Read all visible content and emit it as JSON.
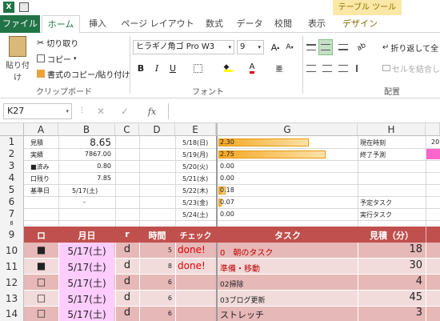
{
  "ribbon_tabs": [
    "ファイル",
    "ホーム",
    "挿入",
    "ページ レイアウト",
    "数式",
    "データ",
    "校閲",
    "表示",
    "デザイン"
  ],
  "context_tab": "テーブル ツール",
  "clipboard": {
    "paste": "貼り付け",
    "cut": "切り取り",
    "copy": "コピー",
    "format_painter": "書式のコピー/貼り付け",
    "group": "クリップボード"
  },
  "font": {
    "name": "ヒラギノ角ゴ Pro W3",
    "size": "9",
    "group": "フォント"
  },
  "align": {
    "wrap": "折り返して全",
    "merge": "セルを結合し",
    "group": "配置"
  },
  "name_box": "K27",
  "fx": "fx",
  "columns": [
    "A",
    "B",
    "C",
    "D",
    "E",
    "G",
    "H"
  ],
  "rows": [
    "1",
    "2",
    "3",
    "4",
    "5",
    "6",
    "7",
    "8",
    "9",
    "10",
    "11",
    "12",
    "13",
    "14"
  ],
  "summary": [
    {
      "label": "見積",
      "value": "8.65"
    },
    {
      "label": "実績",
      "value": "7867.00"
    },
    {
      "label": "■済み",
      "value": "0.80"
    },
    {
      "label": "口残り",
      "value": "7.85"
    },
    {
      "label": "基準日",
      "value": "5/17(土)"
    },
    {
      "label": "",
      "value": "-"
    }
  ],
  "daily": [
    {
      "date": "5/18(日)",
      "value": "2.30",
      "fill": 0.84
    },
    {
      "date": "5/19(月)",
      "value": "2.75",
      "fill": 1.0
    },
    {
      "date": "5/20(火)",
      "value": "0.00",
      "fill": 0
    },
    {
      "date": "5/21(水)",
      "value": "0.00",
      "fill": 0
    },
    {
      "date": "5/22(木)",
      "value": "0.18",
      "fill": 0.07
    },
    {
      "date": "5/23(金)",
      "value": "0.07",
      "fill": 0.03
    },
    {
      "date": "5/24(土)",
      "value": "0.00",
      "fill": 0
    }
  ],
  "right_labels": {
    "r1": "現在時刻",
    "r2": "終了予測",
    "r6": "予定タスク",
    "r7": "実行タスク",
    "k1": "20"
  },
  "table_headers": [
    "ロ",
    "月日",
    "r",
    "時間",
    "チェック",
    "タスク",
    "見積（分）"
  ],
  "table_rows": [
    {
      "box": "■",
      "date": "5/17(土)",
      "r": "d",
      "time": "5",
      "check": "done!",
      "task": "0　朝のタスク",
      "est": "18"
    },
    {
      "box": "■",
      "date": "5/17(土)",
      "r": "d",
      "time": "8",
      "check": "done!",
      "task": "準備・移動",
      "est": "30"
    },
    {
      "box": "□",
      "date": "5/17(土)",
      "r": "d",
      "time": "6",
      "check": "",
      "task": "02掃除",
      "est": "4"
    },
    {
      "box": "□",
      "date": "5/17(土)",
      "r": "d",
      "time": "6",
      "check": "",
      "task": "03ブログ更新",
      "est": "45"
    },
    {
      "box": "□",
      "date": "5/17(土)",
      "r": "d",
      "time": "6",
      "check": "",
      "task": "ストレッチ",
      "est": "3"
    }
  ],
  "colors": {
    "green": "#217346",
    "header_red": "#c0504d",
    "row_pink": "#f2dcdb",
    "row_pink2": "#e6b8b7",
    "date_bg": "#ffcdff",
    "done_red": "#e00000"
  }
}
